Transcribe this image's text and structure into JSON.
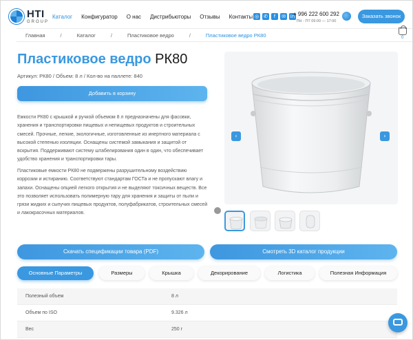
{
  "header": {
    "logo_main": "HTI",
    "logo_sub": "GROUP",
    "nav": [
      {
        "label": "Каталог",
        "active": true
      },
      {
        "label": "Конфигуратор",
        "active": false
      },
      {
        "label": "О нас",
        "active": false
      },
      {
        "label": "Дистрибьюторы",
        "active": false
      },
      {
        "label": "Отзывы",
        "active": false
      },
      {
        "label": "Контакты",
        "active": false
      }
    ],
    "socials": [
      "instagram-icon",
      "whatsapp-icon",
      "facebook-icon",
      "mail-icon",
      "linkedin-icon"
    ],
    "phone": "+ 996 222 600 292",
    "hours": "ПН - ПТ 09:00 — 17:00",
    "order_call": "Заказать звонок"
  },
  "breadcrumb": [
    "Главная",
    "Каталог",
    "Пластиковое ведро",
    "Пластиковое ведро РК80"
  ],
  "cart": {
    "count": "0"
  },
  "product": {
    "title_prefix": "Пластиковое ведро",
    "title_model": "РК80",
    "meta": "Артикул: РК80 / Объем: 8 л / Кол-во на паллете: 840",
    "add_to_cart": "Добавить в корзину",
    "description_1": "Емкости РК80 с крышкой и ручкой объемом 8 л предназначены для фасовки, хранения и транспортировки пищевых и непищевых продуктов и строительных смесей. Прочные, легкие, экологичные, изготовленные из инертного материала с высокой степенью изоляции. Оснащены системой замыкания и защитой от вскрытия. Поддерживают систему штабелирования один в один, что обеспечивает удобство хранения и транспортировки тары.",
    "description_2": "Пластиковые емкости РК80 не подвержены разрушительному воздействию коррозии и истиранию. Соответствуют стандартам ГОСТа и не пропускают влагу и запахи. Оснащены опцией легкого открытия и не выделяют токсичных веществ. Все это позволяет использовать полимерную тару для хранения и защиты от пыли и грязи жидких и сыпучих пищевых продуктов, полуфабрикатов, строительных смесей и лакокрасочных материалов."
  },
  "actions": {
    "spec": "Скачать спецификации товара (PDF)",
    "catalog3d": "Смотреть 3D каталог продукции"
  },
  "tabs": [
    {
      "label": "Основные Параметры",
      "active": true
    },
    {
      "label": "Размеры",
      "active": false
    },
    {
      "label": "Крышка",
      "active": false
    },
    {
      "label": "Декорирование",
      "active": false
    },
    {
      "label": "Логистика",
      "active": false
    },
    {
      "label": "Полезная Информация",
      "active": false
    }
  ],
  "params": [
    {
      "key": "Полезный объем",
      "value": "8 л"
    },
    {
      "key": "Объем по ISO",
      "value": "9.326 л"
    },
    {
      "key": "Вес",
      "value": "250 г"
    }
  ],
  "colors": {
    "accent": "#3a98e0",
    "title": "#3a98e0"
  }
}
